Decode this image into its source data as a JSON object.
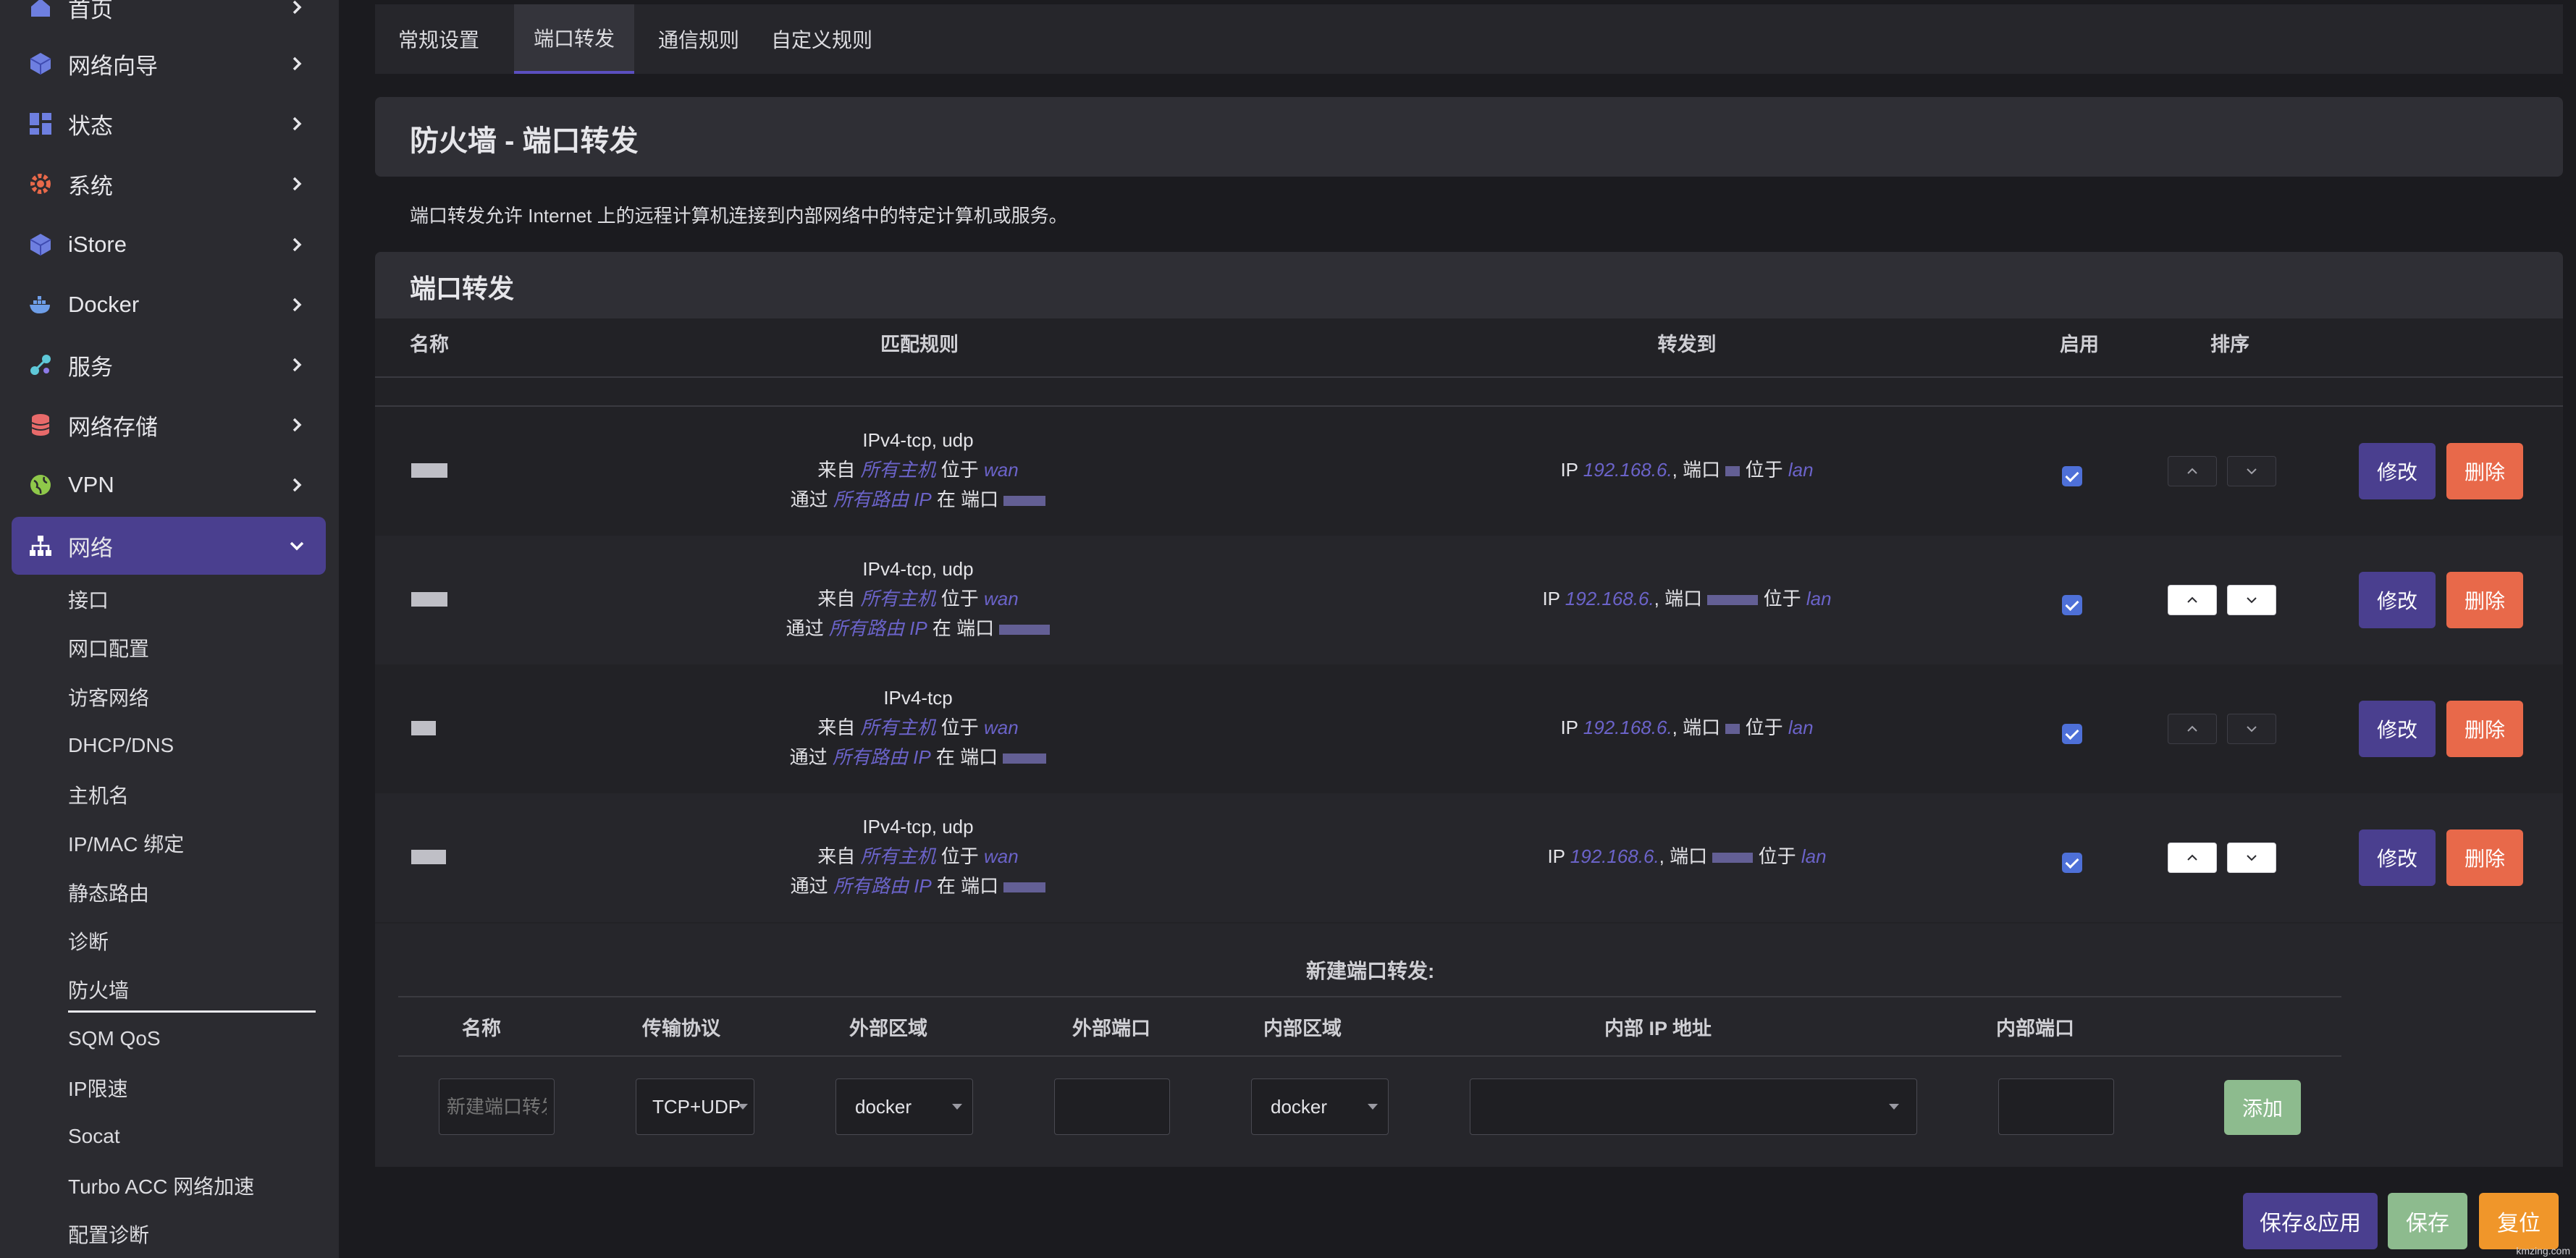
{
  "sidebar": {
    "items": [
      {
        "label": "首页",
        "icon": "home-icon"
      },
      {
        "label": "网络向导",
        "icon": "cube-icon"
      },
      {
        "label": "状态",
        "icon": "dashboard-icon"
      },
      {
        "label": "系统",
        "icon": "gear-icon"
      },
      {
        "label": "iStore",
        "icon": "cube-icon"
      },
      {
        "label": "Docker",
        "icon": "docker-icon"
      },
      {
        "label": "服务",
        "icon": "services-icon"
      },
      {
        "label": "网络存储",
        "icon": "database-icon"
      },
      {
        "label": "VPN",
        "icon": "globe-icon"
      },
      {
        "label": "网络",
        "icon": "network-icon"
      }
    ],
    "sub_items": [
      "接口",
      "网口配置",
      "访客网络",
      "DHCP/DNS",
      "主机名",
      "IP/MAC 绑定",
      "静态路由",
      "诊断",
      "防火墙",
      "SQM QoS",
      "IP限速",
      "Socat",
      "Turbo ACC 网络加速",
      "配置诊断"
    ],
    "active_sub": "防火墙"
  },
  "tabs": [
    "常规设置",
    "端口转发",
    "通信规则",
    "自定义规则"
  ],
  "active_tab": "端口转发",
  "page_title": "防火墙 - 端口转发",
  "description": "端口转发允许 Internet 上的远程计算机连接到内部网络中的特定计算机或服务。",
  "section_title": "端口转发",
  "table": {
    "headers": {
      "name": "名称",
      "match": "匹配规则",
      "forward": "转发到",
      "enable": "启用",
      "sort": "排序"
    },
    "rows": [
      {
        "proto": "IPv4-tcp, udp",
        "from_label": "来自",
        "from_host": "所有主机",
        "at_label": "位于",
        "src_zone": "wan",
        "via_label": "通过",
        "via_ip": "所有路由 IP",
        "port_label": "在 端口",
        "fwd_ip_label": "IP",
        "fwd_ip": "192.168.6.",
        "fwd_port_label": ", 端口",
        "fwd_at": "位于",
        "dest_zone": "lan",
        "enabled": true
      },
      {
        "proto": "IPv4-tcp, udp",
        "from_label": "来自",
        "from_host": "所有主机",
        "at_label": "位于",
        "src_zone": "wan",
        "via_label": "通过",
        "via_ip": "所有路由 IP",
        "port_label": "在 端口",
        "fwd_ip_label": "IP",
        "fwd_ip": "192.168.6.",
        "fwd_port_label": ", 端口",
        "fwd_at": "位于",
        "dest_zone": "lan",
        "enabled": true
      },
      {
        "proto": "IPv4-tcp",
        "from_label": "来自",
        "from_host": "所有主机",
        "at_label": "位于",
        "src_zone": "wan",
        "via_label": "通过",
        "via_ip": "所有路由 IP",
        "port_label": "在 端口",
        "fwd_ip_label": "IP",
        "fwd_ip": "192.168.6.",
        "fwd_port_label": ", 端口",
        "fwd_at": "位于",
        "dest_zone": "lan",
        "enabled": true
      },
      {
        "proto": "IPv4-tcp, udp",
        "from_label": "来自",
        "from_host": "所有主机",
        "at_label": "位于",
        "src_zone": "wan",
        "via_label": "通过",
        "via_ip": "所有路由 IP",
        "port_label": "在 端口",
        "fwd_ip_label": "IP",
        "fwd_ip": "192.168.6.",
        "fwd_port_label": ", 端口",
        "fwd_at": "位于",
        "dest_zone": "lan",
        "enabled": true
      }
    ],
    "edit_label": "修改",
    "delete_label": "删除"
  },
  "new_forward": {
    "title": "新建端口转发:",
    "headers": [
      "名称",
      "传输协议",
      "外部区域",
      "外部端口",
      "内部区域",
      "内部 IP 地址",
      "内部端口"
    ],
    "name_placeholder": "新建端口转发",
    "protocol": "TCP+UDP",
    "ext_zone": "docker",
    "int_zone": "docker",
    "add_label": "添加"
  },
  "footer": {
    "save_apply": "保存&应用",
    "save": "保存",
    "reset": "复位"
  },
  "watermark": "kmzing.com",
  "colors": {
    "accent": "#4a3f8f",
    "danger": "#e8694a",
    "success": "#8dbb8e",
    "warning": "#f0962a",
    "link": "#6b63c9"
  }
}
